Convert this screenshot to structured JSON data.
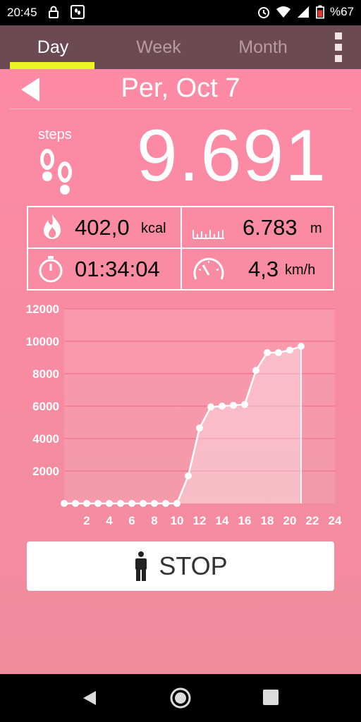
{
  "status": {
    "time": "20:45",
    "battery": "%67"
  },
  "tabs": [
    {
      "label": "Day"
    },
    {
      "label": "Week"
    },
    {
      "label": "Month"
    }
  ],
  "header": {
    "date": "Per, Oct 7"
  },
  "steps": {
    "label": "steps",
    "count": "9.691"
  },
  "stats": {
    "calories": {
      "value": "402,0",
      "unit": "kcal"
    },
    "distance": {
      "value": "6.783",
      "unit": "m"
    },
    "duration": {
      "value": "01:34:04"
    },
    "speed": {
      "value": "4,3",
      "unit": "km/h"
    }
  },
  "stop_button": {
    "label": "STOP"
  },
  "colors": {
    "accent": "#eef522",
    "tabbar": "#6b4a53",
    "background": "#f88ba2"
  },
  "chart_data": {
    "type": "area",
    "xlim": [
      0,
      24
    ],
    "ylim": [
      0,
      12000
    ],
    "xticks": [
      2,
      4,
      6,
      8,
      10,
      12,
      14,
      16,
      18,
      20,
      22,
      24
    ],
    "yticks": [
      2000,
      4000,
      6000,
      8000,
      10000,
      12000
    ],
    "grid": true,
    "x": [
      0,
      1,
      2,
      3,
      4,
      5,
      6,
      7,
      8,
      9,
      10,
      11,
      12,
      13,
      14,
      15,
      16,
      17,
      18,
      19,
      20,
      21
    ],
    "y": [
      0,
      0,
      0,
      0,
      0,
      0,
      0,
      0,
      0,
      0,
      0,
      1700,
      4650,
      5950,
      6000,
      6050,
      6100,
      8200,
      9300,
      9300,
      9450,
      9691
    ]
  }
}
